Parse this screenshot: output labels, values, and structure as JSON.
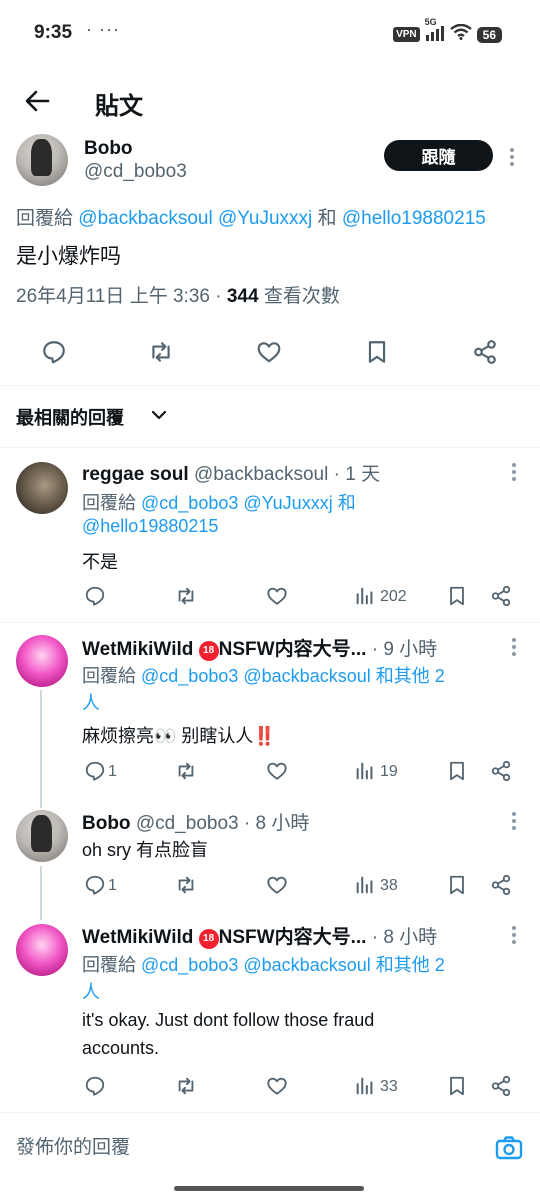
{
  "status_bar": {
    "time": "9:35",
    "dots": "·  ···",
    "vpn": "VPN",
    "network": "5G",
    "battery": "56"
  },
  "header": {
    "title": "貼文"
  },
  "main_post": {
    "author_name": "Bobo",
    "author_handle": "@cd_bobo3",
    "follow_label": "跟隨",
    "reply_prefix": "回覆給",
    "reply_to_1": "@backbacksoul",
    "reply_to_2": "@YuJuxxxj",
    "reply_and": "和",
    "reply_to_3": "@hello19880215",
    "text": "是小爆炸吗",
    "date": "26年4月11日 上午 3:36 ·",
    "views_count": "344",
    "views_label": "查看次數"
  },
  "sort": {
    "label": "最相關的回覆"
  },
  "replies": [
    {
      "name": "reggae soul",
      "handle": "@backbacksoul",
      "time": "· 1 天",
      "reply_prefix": "回覆給",
      "reply_to_1": "@cd_bobo3",
      "reply_to_2": "@YuJuxxxj",
      "reply_and": "和",
      "reply_to_3": "@hello19880215",
      "text": "不是",
      "replies_count": "",
      "views": "202"
    },
    {
      "name": "WetMikiWild",
      "name_badge": "18",
      "name_suffix": "NSFW内容大号...",
      "time": "· 9 小時",
      "reply_prefix": "回覆給",
      "reply_to_1": "@cd_bobo3",
      "reply_to_2": "@backbacksoul",
      "reply_others": "和其他 2",
      "reply_others_2": "人",
      "text": "麻烦擦亮👀 别瞎认人",
      "text_bang": "‼️",
      "replies_count": "1",
      "views": "19"
    },
    {
      "name": "Bobo",
      "handle": "@cd_bobo3",
      "time": "· 8 小時",
      "text": "oh sry 有点脸盲",
      "replies_count": "1",
      "views": "38"
    },
    {
      "name": "WetMikiWild",
      "name_badge": "18",
      "name_suffix": "NSFW内容大号...",
      "time": "· 8 小時",
      "reply_prefix": "回覆給",
      "reply_to_1": "@cd_bobo3",
      "reply_to_2": "@backbacksoul",
      "reply_others": "和其他 2",
      "reply_others_2": "人",
      "text_line_1": "it's okay. Just dont follow those fraud",
      "text_line_2": "accounts.",
      "replies_count": "",
      "views": "33"
    }
  ],
  "composer": {
    "placeholder": "發佈你的回覆"
  },
  "colors": {
    "accent": "#1d9bf0",
    "text": "#0f1419",
    "secondary": "#536471",
    "divider": "#eff3f4",
    "alert": "#f4212e"
  },
  "icons": [
    "back-arrow-icon",
    "more-icon",
    "reply-icon",
    "retweet-icon",
    "like-icon",
    "bookmark-icon",
    "share-icon",
    "views-icon",
    "chevron-down-icon",
    "camera-icon"
  ]
}
